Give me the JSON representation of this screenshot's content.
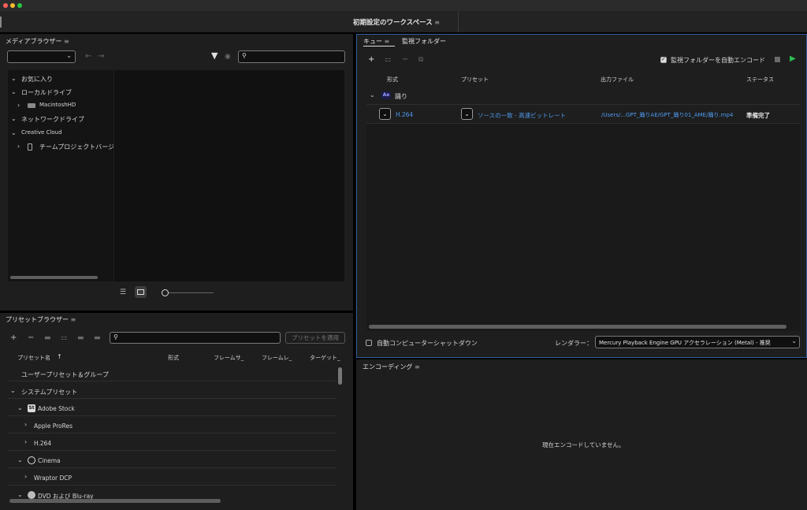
{
  "window": {
    "workspace_title": "初期設定のワークスペース",
    "workspace_menu_icon": "hamburger-icon"
  },
  "media_browser": {
    "title": "メディアブラウザー",
    "location_value": "",
    "tree": [
      {
        "label": "お気に入り",
        "expanded": true
      },
      {
        "label": "ローカルドライブ",
        "expanded": true
      },
      {
        "label": "MacintoshHD",
        "expanded": false
      },
      {
        "label": "ネットワークドライブ",
        "expanded": true
      },
      {
        "label": "Creative Cloud",
        "expanded": true
      },
      {
        "label": "チームプロジェクトバージョ",
        "expanded": false
      }
    ],
    "search_placeholder": ""
  },
  "queue": {
    "tabs": [
      "キュー",
      "監視フォルダー"
    ],
    "auto_encode_label": "監視フォルダーを自動エンコード",
    "auto_encode_checked": true,
    "columns": [
      "形式",
      "プリセット",
      "出力ファイル",
      "ステータス"
    ],
    "group": {
      "badge": "Ae",
      "name": "踊り"
    },
    "item": {
      "format": "H.264",
      "preset": "ソースの一致 - 高速ビットレート",
      "output": "/Users/...GPT_踊りAE/GPT_踊り01_AME/踊り.mp4",
      "status": "準備完了"
    },
    "auto_shutdown_label": "自動コンピューターシャットダウン",
    "renderer_label": "レンダラー：",
    "renderer_value": "Mercury Playback Engine GPU アクセラレーション (Metal) - 推奨"
  },
  "preset_browser": {
    "title": "プリセットブラウザー",
    "apply_label": "プリセットを適用",
    "search_placeholder": "",
    "columns": [
      "プリセット名",
      "形式",
      "フレームサ_",
      "フレームレ_",
      "ターゲット_"
    ],
    "rows": [
      {
        "label": "ユーザープリセット＆グループ",
        "indent": 0,
        "chevron": ""
      },
      {
        "label": "システムプリセット",
        "indent": 0,
        "chevron": "v"
      },
      {
        "label": "Adobe Stock",
        "indent": 1,
        "chevron": "v",
        "icon": "adobe-stock-icon"
      },
      {
        "label": "Apple ProRes",
        "indent": 2,
        "chevron": ">"
      },
      {
        "label": "H.264",
        "indent": 2,
        "chevron": ">"
      },
      {
        "label": "Cinema",
        "indent": 1,
        "chevron": "v",
        "icon": "cinema-icon"
      },
      {
        "label": "Wraptor DCP",
        "indent": 2,
        "chevron": ">"
      },
      {
        "label": "DVD および Blu-ray",
        "indent": 1,
        "chevron": "v",
        "icon": "disc-icon"
      }
    ]
  },
  "encoding": {
    "title": "エンコーディング",
    "empty_message": "現在エンコードしていません。"
  }
}
